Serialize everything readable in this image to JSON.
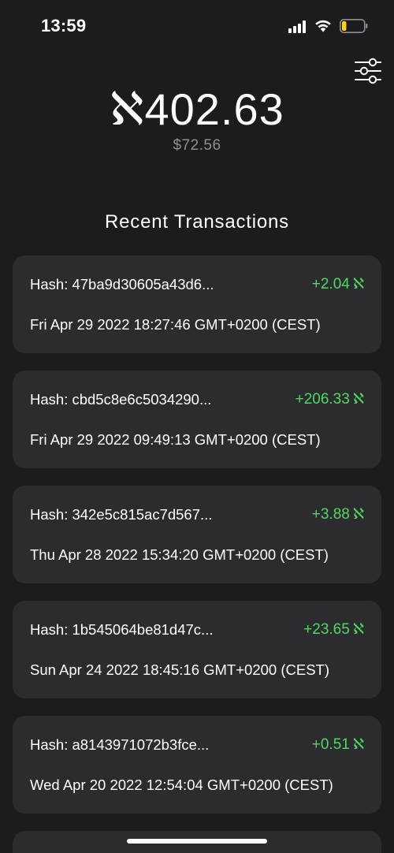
{
  "status_bar": {
    "time": "13:59",
    "battery_level": 0.2,
    "battery_color": "#ffd60a"
  },
  "header": {
    "filter_icon": "sliders-icon",
    "balance_symbol": "ℵ",
    "balance_value": "402.63",
    "fiat_value": "$72.56"
  },
  "transactions_section": {
    "title": "Recent Transactions"
  },
  "transactions": [
    {
      "hash": "Hash: 47ba9d30605a43d6...",
      "amount": "+2.04",
      "unit": "ℵ",
      "date": "Fri Apr 29 2022 18:27:46 GMT+0200 (CEST)"
    },
    {
      "hash": "Hash: cbd5c8e6c5034290...",
      "amount": "+206.33",
      "unit": "ℵ",
      "date": "Fri Apr 29 2022 09:49:13 GMT+0200 (CEST)"
    },
    {
      "hash": "Hash: 342e5c815ac7d567...",
      "amount": "+3.88",
      "unit": "ℵ",
      "date": "Thu Apr 28 2022 15:34:20 GMT+0200 (CEST)"
    },
    {
      "hash": "Hash: 1b545064be81d47c...",
      "amount": "+23.65",
      "unit": "ℵ",
      "date": "Sun Apr 24 2022 18:45:16 GMT+0200 (CEST)"
    },
    {
      "hash": "Hash: a8143971072b3fce...",
      "amount": "+0.51",
      "unit": "ℵ",
      "date": "Wed Apr 20 2022 12:54:04 GMT+0200 (CEST)"
    }
  ],
  "colors": {
    "background": "#1c1c1e",
    "card": "#2c2c2e",
    "positive_amount": "#4cd964",
    "secondary_text": "#8e8e93"
  }
}
